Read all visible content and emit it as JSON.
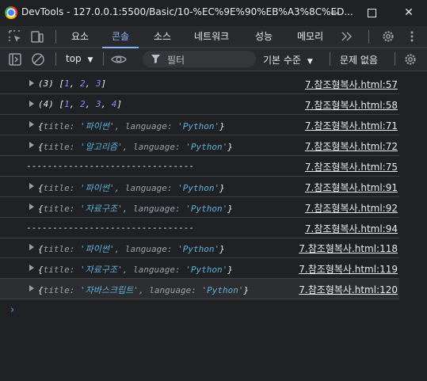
{
  "window": {
    "app_name": "DevTools",
    "url": "127.0.0.1:5500/Basic/10-%EC%9E%90%EB%A3%8C%ED..."
  },
  "tabs": [
    "요소",
    "콘솔",
    "소스",
    "네트워크",
    "성능",
    "메모리"
  ],
  "active_tab": "콘솔",
  "toolbar": {
    "context": "top",
    "filter_placeholder": "필터",
    "levels": "기본 수준",
    "issues": "문제 없음"
  },
  "console_rows": [
    {
      "prefix": "(3)",
      "array": [
        "1",
        "2",
        "3"
      ],
      "source": "7.참조형복사.html:57"
    },
    {
      "prefix": "(4)",
      "array": [
        "1",
        "2",
        "3",
        "4"
      ],
      "source": "7.참조형복사.html:58"
    },
    {
      "title": "'파이썬'",
      "language": "'Python'",
      "source": "7.참조형복사.html:71"
    },
    {
      "title": "'알고리즘'",
      "language": "'Python'",
      "source": "7.참조형복사.html:72"
    },
    {
      "text": "--------------------------------",
      "source": "7.참조형복사.html:75"
    },
    {
      "title": "'파이썬'",
      "language": "'Python'",
      "source": "7.참조형복사.html:91"
    },
    {
      "title": "'자료구조'",
      "language": "'Python'",
      "source": "7.참조형복사.html:92"
    },
    {
      "text": "--------------------------------",
      "source": "7.참조형복사.html:94"
    },
    {
      "title": "'파이썬'",
      "language": "'Python'",
      "source": "7.참조형복사.html:118"
    },
    {
      "title": "'자료구조'",
      "language": "'Python'",
      "source": "7.참조형복사.html:119"
    },
    {
      "title": "'자바스크립트'",
      "language": "'Python'",
      "source": "7.참조형복사.html:120"
    }
  ],
  "object_keys": {
    "title": "title",
    "language": "language"
  },
  "prompt": "›"
}
